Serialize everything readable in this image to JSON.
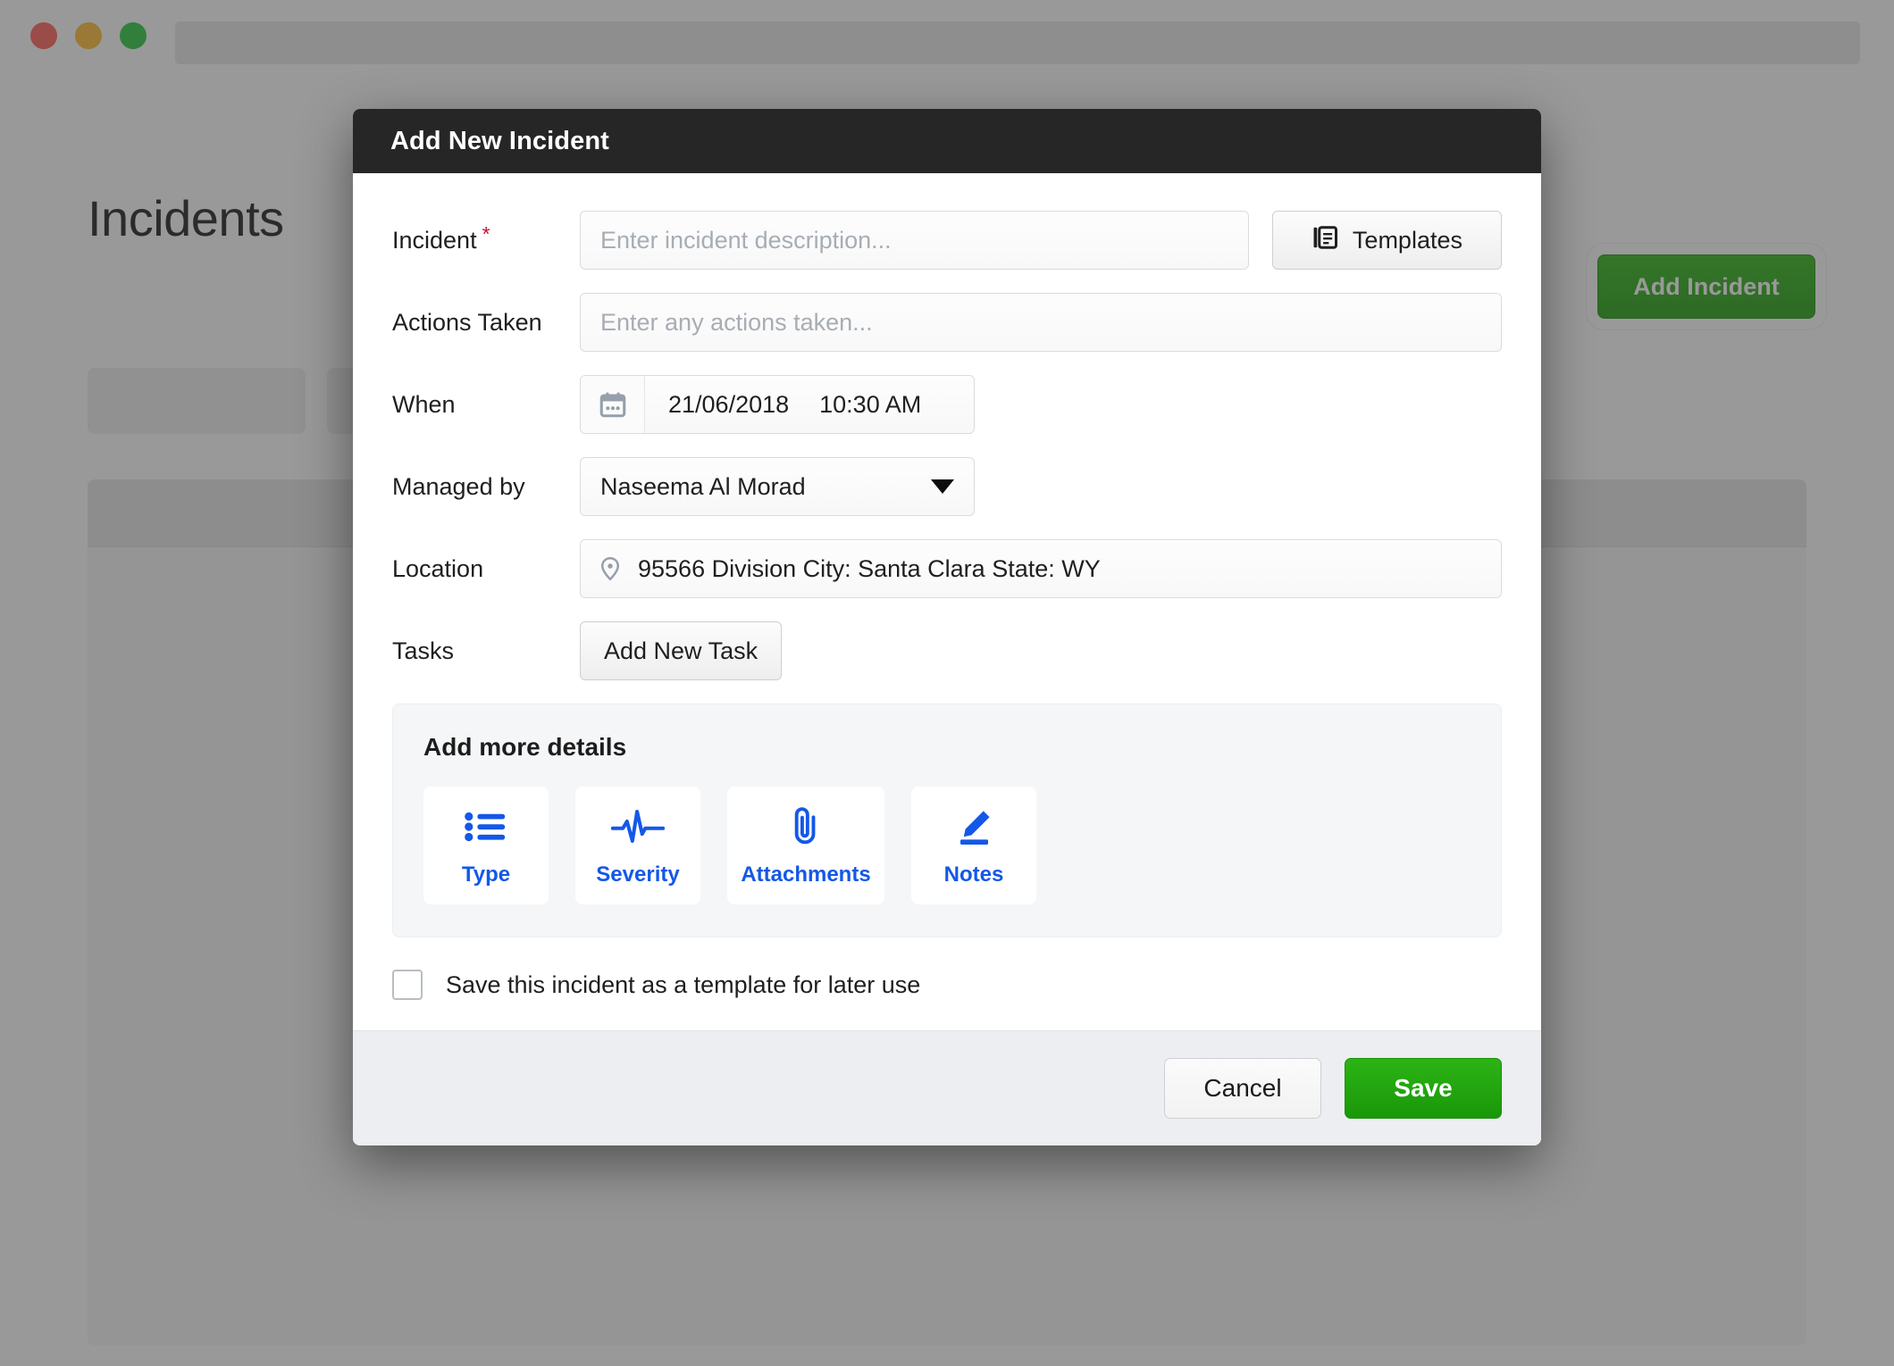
{
  "browser": {
    "traffic_lights": [
      "close",
      "minimize",
      "zoom"
    ],
    "url_value": ""
  },
  "page": {
    "title": "Incidents",
    "add_incident_label": "Add Incident",
    "accent_green": "#2cb415"
  },
  "modal": {
    "title": "Add New Incident",
    "header_bg": "#262626",
    "fields": {
      "incident": {
        "label": "Incident",
        "required_marker": "*",
        "required_color": "#c8102e",
        "placeholder": "Enter incident description...",
        "value": ""
      },
      "actions_taken": {
        "label": "Actions Taken",
        "placeholder": "Enter any actions taken...",
        "value": ""
      },
      "when": {
        "label": "When",
        "date": "21/06/2018",
        "time": "10:30 AM",
        "icon": "calendar-icon"
      },
      "managed_by": {
        "label": "Managed by",
        "selected": "Naseema Al Morad",
        "icon": "chevron-down-icon"
      },
      "location": {
        "label": "Location",
        "value": "95566 Division City: Santa Clara State: WY",
        "icon": "map-pin-icon"
      },
      "tasks": {
        "label": "Tasks",
        "button_label": "Add New Task"
      }
    },
    "templates_button": {
      "label": "Templates",
      "icon": "library-icon"
    },
    "details_panel": {
      "title": "Add more details",
      "accent_blue": "#1358e8",
      "cards": [
        {
          "label": "Type",
          "icon": "list-icon"
        },
        {
          "label": "Severity",
          "icon": "pulse-icon"
        },
        {
          "label": "Attachments",
          "icon": "paperclip-icon"
        },
        {
          "label": "Notes",
          "icon": "pencil-icon"
        }
      ]
    },
    "template_checkbox": {
      "label": "Save this incident as a template for later use",
      "checked": false
    },
    "footer": {
      "cancel_label": "Cancel",
      "save_label": "Save"
    }
  }
}
